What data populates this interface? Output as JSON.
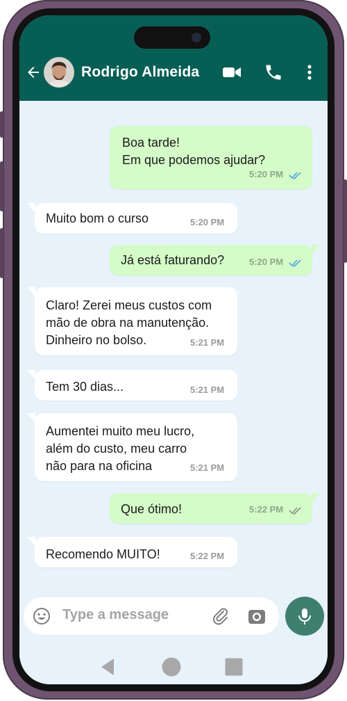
{
  "header": {
    "contact_name": "Rodrigo Almeida",
    "icons": [
      "back-arrow-icon",
      "video-call-icon",
      "phone-icon",
      "more-options-icon"
    ],
    "color": "#075e54"
  },
  "messages": [
    {
      "dir": "out",
      "lines": [
        "Boa tarde!",
        "Em que podemos ajudar?"
      ],
      "time": "5:20 PM",
      "status": "read"
    },
    {
      "dir": "in",
      "lines": [
        "Muito bom o curso"
      ],
      "time": "5:20 PM"
    },
    {
      "dir": "out",
      "lines": [
        "Já está faturando?"
      ],
      "time": "5:20 PM",
      "status": "read"
    },
    {
      "dir": "in",
      "lines": [
        "Claro! Zerei meus custos com",
        "mão de obra na manutenção.",
        "Dinheiro no bolso."
      ],
      "time": "5:21 PM"
    },
    {
      "dir": "in",
      "lines": [
        "Tem 30 dias..."
      ],
      "time": "5:21 PM"
    },
    {
      "dir": "in",
      "lines": [
        "Aumentei muito meu lucro,",
        "além do custo, meu carro",
        "não para na oficina"
      ],
      "time": "5:21 PM"
    },
    {
      "dir": "out",
      "lines": [
        "Que ótimo!"
      ],
      "time": "5:22 PM",
      "status": "delivered"
    },
    {
      "dir": "in",
      "lines": [
        "Recomendo MUITO!"
      ],
      "time": "5:22 PM"
    }
  ],
  "composer": {
    "placeholder": "Type a message",
    "icons": [
      "emoji-icon",
      "attach-icon",
      "camera-icon",
      "mic-icon"
    ]
  },
  "system_nav": {
    "icons": [
      "nav-back-icon",
      "nav-home-icon",
      "nav-recents-icon"
    ]
  },
  "colors": {
    "chat_bg": "#e8f2fb",
    "outgoing_bubble": "#d4fbc8",
    "incoming_bubble": "#ffffff",
    "read_tick": "#4fa3e0",
    "mic_button": "#3f7f6e"
  }
}
